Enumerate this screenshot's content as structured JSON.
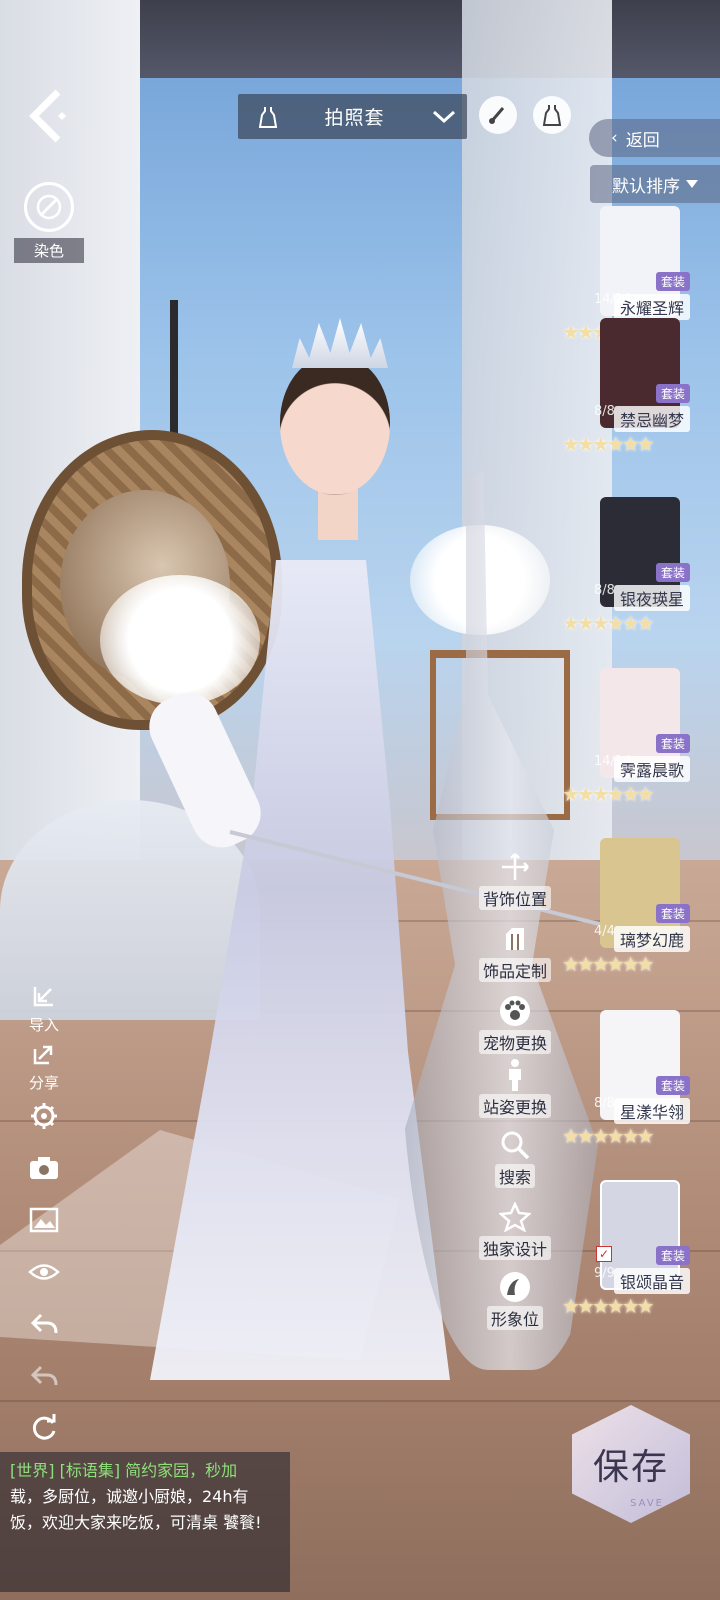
{
  "top_bar": {
    "outfit_category": "拍照套"
  },
  "dye": {
    "label": "染色"
  },
  "right_panel": {
    "return_label": "返回",
    "sort_label": "默认排序",
    "tag_label": "套装",
    "suits": [
      {
        "name": "永耀圣辉",
        "count": "14/14",
        "stars": "★★★★★★",
        "color": "#f1f3f8"
      },
      {
        "name": "禁忌幽梦",
        "count": "8/8",
        "stars": "★★★★★★",
        "color": "#4a2a2e"
      },
      {
        "name": "银夜瑛星",
        "count": "8/8",
        "stars": "★★★★★★",
        "color": "#2b2c36"
      },
      {
        "name": "霁露晨歌",
        "count": "14/14",
        "stars": "★★★★★★",
        "color": "#f4e7ea"
      },
      {
        "name": "璃梦幻鹿",
        "count": "4/4",
        "stars": "★★★★★★",
        "color": "#d9c58f"
      },
      {
        "name": "星漾华翎",
        "count": "8/8",
        "stars": "★★★★★★",
        "color": "#f5f5f7"
      },
      {
        "name": "银颂晶音",
        "count": "9/9",
        "stars": "★★★★★★",
        "color": "#d4d6e4",
        "selected": true
      }
    ]
  },
  "left_tools": [
    {
      "label": "导入",
      "icon": "import-icon"
    },
    {
      "label": "分享",
      "icon": "share-icon"
    },
    {
      "label": "",
      "icon": "settings-icon"
    },
    {
      "label": "",
      "icon": "camera-icon"
    },
    {
      "label": "",
      "icon": "image-icon"
    },
    {
      "label": "",
      "icon": "eye-icon"
    },
    {
      "label": "",
      "icon": "undo-icon"
    },
    {
      "label": "",
      "icon": "redo-icon"
    },
    {
      "label": "",
      "icon": "reset-icon"
    }
  ],
  "center_menu": [
    {
      "label": "背饰位置",
      "icon": "move-icon"
    },
    {
      "label": "饰品定制",
      "icon": "custom-icon"
    },
    {
      "label": "宠物更换",
      "icon": "paw-icon"
    },
    {
      "label": "站姿更换",
      "icon": "pose-icon"
    },
    {
      "label": "搜索",
      "icon": "search-icon"
    },
    {
      "label": "独家设计",
      "icon": "star-icon"
    },
    {
      "label": "形象位",
      "icon": "avatar-icon"
    }
  ],
  "chat": {
    "tagline": "[世界] [标语集] 简约家园，秒加",
    "message": "载，多厨位，诚邀小厨娘，24h有饭，欢迎大家来吃饭，可清桌 饕餮!"
  },
  "save": {
    "label": "保存",
    "sub": "SAVE"
  },
  "colors": {
    "accent": "#8b72c9",
    "panel": "#3c465a",
    "star": "#f3dea5"
  }
}
